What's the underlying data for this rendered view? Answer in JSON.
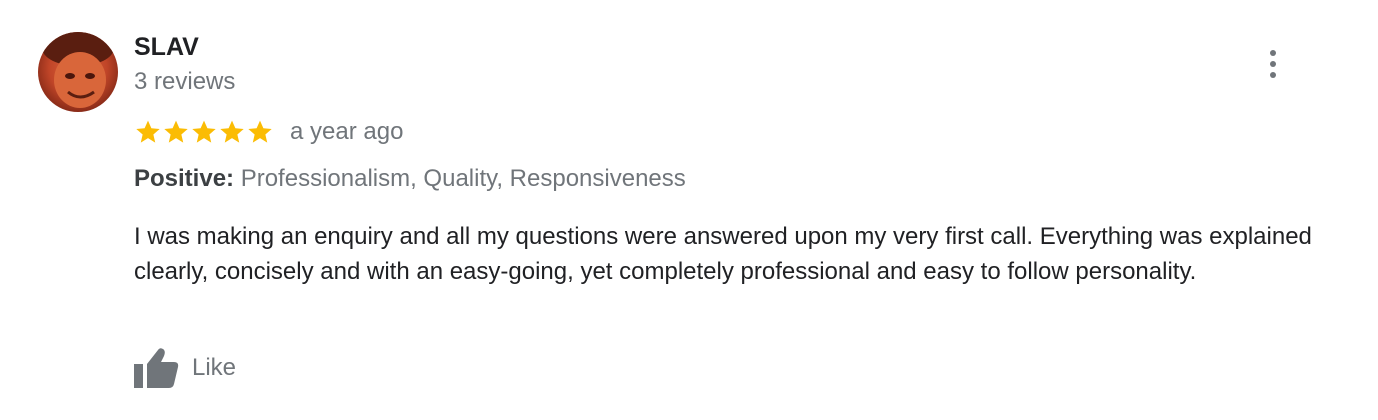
{
  "review": {
    "author": {
      "name": "SLAV",
      "review_count": "3 reviews"
    },
    "rating": {
      "stars": 5,
      "max": 5,
      "color": "#fbbc04"
    },
    "time_ago": "a year ago",
    "attributes": {
      "label": "Positive:",
      "values": "Professionalism, Quality, Responsiveness"
    },
    "text": "I was making an enquiry and all my questions were answered upon my very first call. Everything was explained clearly, concisely and with an easy-going, yet completely professional and easy to follow personality.",
    "actions": {
      "like_label": "Like"
    },
    "icons": {
      "more": "more-vert-icon",
      "like": "thumbs-up-icon",
      "star": "star-icon"
    }
  }
}
